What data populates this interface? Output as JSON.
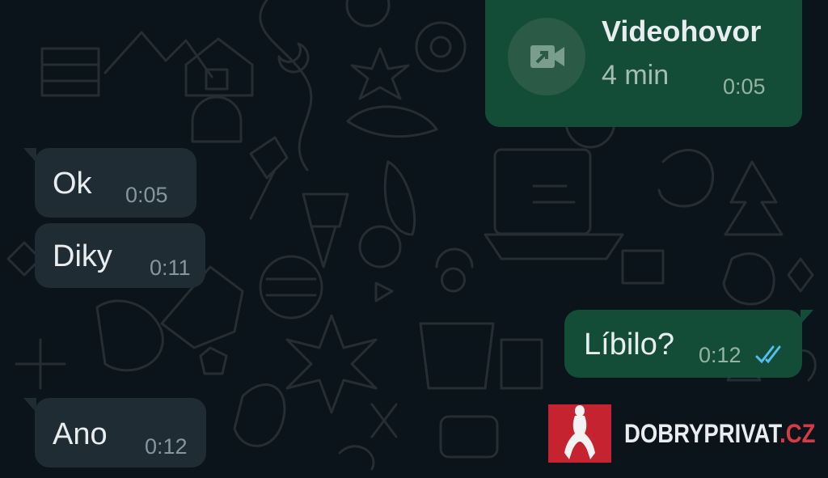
{
  "colors": {
    "background": "#0b141a",
    "incoming_bubble": "#1f2c33",
    "outgoing_bubble": "#144d37",
    "read_ticks": "#53bdeb",
    "logo_red": "#c5232f"
  },
  "call": {
    "title": "Videohovor",
    "duration": "4 min",
    "time": "0:05",
    "icon": "video-call-icon"
  },
  "messages": [
    {
      "direction": "incoming",
      "text": "Ok",
      "time": "0:05"
    },
    {
      "direction": "incoming",
      "text": "Diky",
      "time": "0:11"
    },
    {
      "direction": "outgoing",
      "text": "Líbilo?",
      "time": "0:12",
      "status": "read",
      "status_icon": "double-check-icon"
    },
    {
      "direction": "incoming",
      "text": "Ano",
      "time": "0:12"
    }
  ],
  "watermark": {
    "text_main": "DOBRYPRIVAT",
    "text_suffix": ".CZ",
    "icon": "silhouette-logo-icon"
  }
}
